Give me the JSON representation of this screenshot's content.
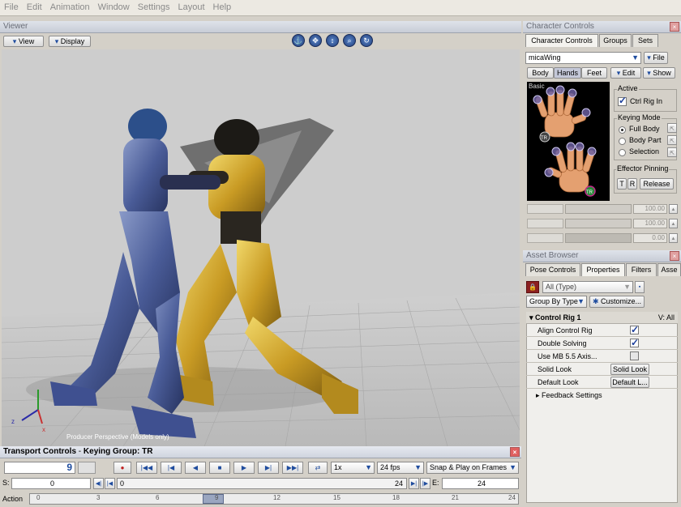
{
  "menu": [
    "File",
    "Edit",
    "Animation",
    "Window",
    "Settings",
    "Layout",
    "Help"
  ],
  "viewer": {
    "title": "Viewer",
    "view_label": "View",
    "display_label": "Display",
    "camera_label": "Producer Perspective (Models only)",
    "axis_x": "x",
    "axis_z": "z"
  },
  "transport": {
    "title": "Transport Controls",
    "keying_group": "Keying Group: TR",
    "frame": "9",
    "speed": "1x",
    "fps": "24 fps",
    "snap": "Snap & Play on Frames",
    "start_label": "S:",
    "start_value": "0",
    "range_start": "0",
    "range_end": "24",
    "end_label": "E:",
    "end_value": "24",
    "action_label": "Action",
    "ticks": [
      "0",
      "3",
      "6",
      "9",
      "12",
      "15",
      "18",
      "21",
      "24"
    ]
  },
  "character_controls": {
    "title": "Character Controls",
    "tabs": [
      "Character Controls",
      "Groups",
      "Sets"
    ],
    "character": "micaWing",
    "file_label": "File",
    "subtabs": [
      "Body",
      "Hands",
      "Feet"
    ],
    "edit_label": "Edit",
    "show_label": "Show",
    "basic_label": "Basic",
    "tr_badge": "TR",
    "active_label": "Active",
    "ctrl_rig_in": "Ctrl Rig In",
    "keying_mode_label": "Keying Mode",
    "keying_modes": [
      "Full Body",
      "Body Part",
      "Selection"
    ],
    "effector_pinning_label": "Effector Pinning",
    "t_label": "T",
    "r_label": "R",
    "release_label": "Release",
    "reach_values": [
      "100.00",
      "100.00",
      "0.00"
    ]
  },
  "asset_browser": {
    "title": "Asset Browser",
    "tabs": [
      "Pose Controls",
      "Properties",
      "Filters",
      "Asse"
    ],
    "type_filter": "All (Type)",
    "group_by": "Group By Type",
    "customize": "Customize...",
    "section": "Control Rig 1",
    "section_right": "V: All",
    "rows": [
      {
        "label": "Align Control Rig",
        "kind": "check",
        "checked": true
      },
      {
        "label": "Double Solving",
        "kind": "check",
        "checked": true
      },
      {
        "label": "Use MB 5.5 Axis...",
        "kind": "check",
        "checked": false
      },
      {
        "label": "Solid Look",
        "kind": "button",
        "button": "Solid Look"
      },
      {
        "label": "Default Look",
        "kind": "button",
        "button": "Default L..."
      }
    ],
    "feedback": "Feedback Settings"
  },
  "colors": {
    "accent": "#1f4c9e",
    "viewport_bg": "#cdcdcd",
    "hand_bg": "#000000"
  }
}
